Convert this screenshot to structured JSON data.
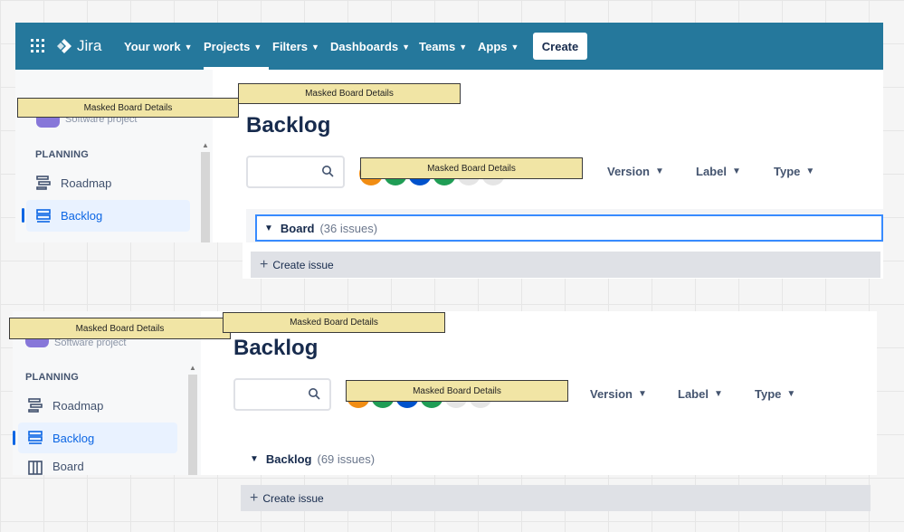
{
  "nav": {
    "brand": "Jira",
    "items": [
      {
        "label": "Your work"
      },
      {
        "label": "Projects"
      },
      {
        "label": "Filters"
      },
      {
        "label": "Dashboards"
      },
      {
        "label": "Teams"
      },
      {
        "label": "Apps"
      }
    ],
    "create_label": "Create",
    "colors": {
      "bar": "#25789c",
      "accent": "#0c66e4"
    }
  },
  "mask_label": "Masked Board Details",
  "top": {
    "project_subtitle": "Software project",
    "planning_heading": "PLANNING",
    "sidebar_items": [
      {
        "label": "Roadmap",
        "icon": "roadmap-icon"
      },
      {
        "label": "Backlog",
        "icon": "backlog-icon"
      }
    ],
    "page_title": "Backlog",
    "filters": {
      "version": "Version",
      "label": "Label",
      "type": "Type"
    },
    "group": {
      "name": "Board",
      "count": "(36 issues)"
    },
    "create_issue": "Create issue"
  },
  "bottom": {
    "project_subtitle": "Software project",
    "planning_heading": "PLANNING",
    "sidebar_items": [
      {
        "label": "Roadmap",
        "icon": "roadmap-icon"
      },
      {
        "label": "Backlog",
        "icon": "backlog-icon"
      },
      {
        "label": "Board",
        "icon": "board-icon"
      }
    ],
    "page_title": "Backlog",
    "filters": {
      "version": "Version",
      "label": "Label",
      "type": "Type"
    },
    "group": {
      "name": "Backlog",
      "count": "(69 issues)"
    },
    "create_issue": "Create issue"
  },
  "avatar_colors": [
    "#f18d13",
    "#1f9d55",
    "#0052cc",
    "#1f9d55",
    "#e5e5e5",
    "#e5e5e5"
  ]
}
